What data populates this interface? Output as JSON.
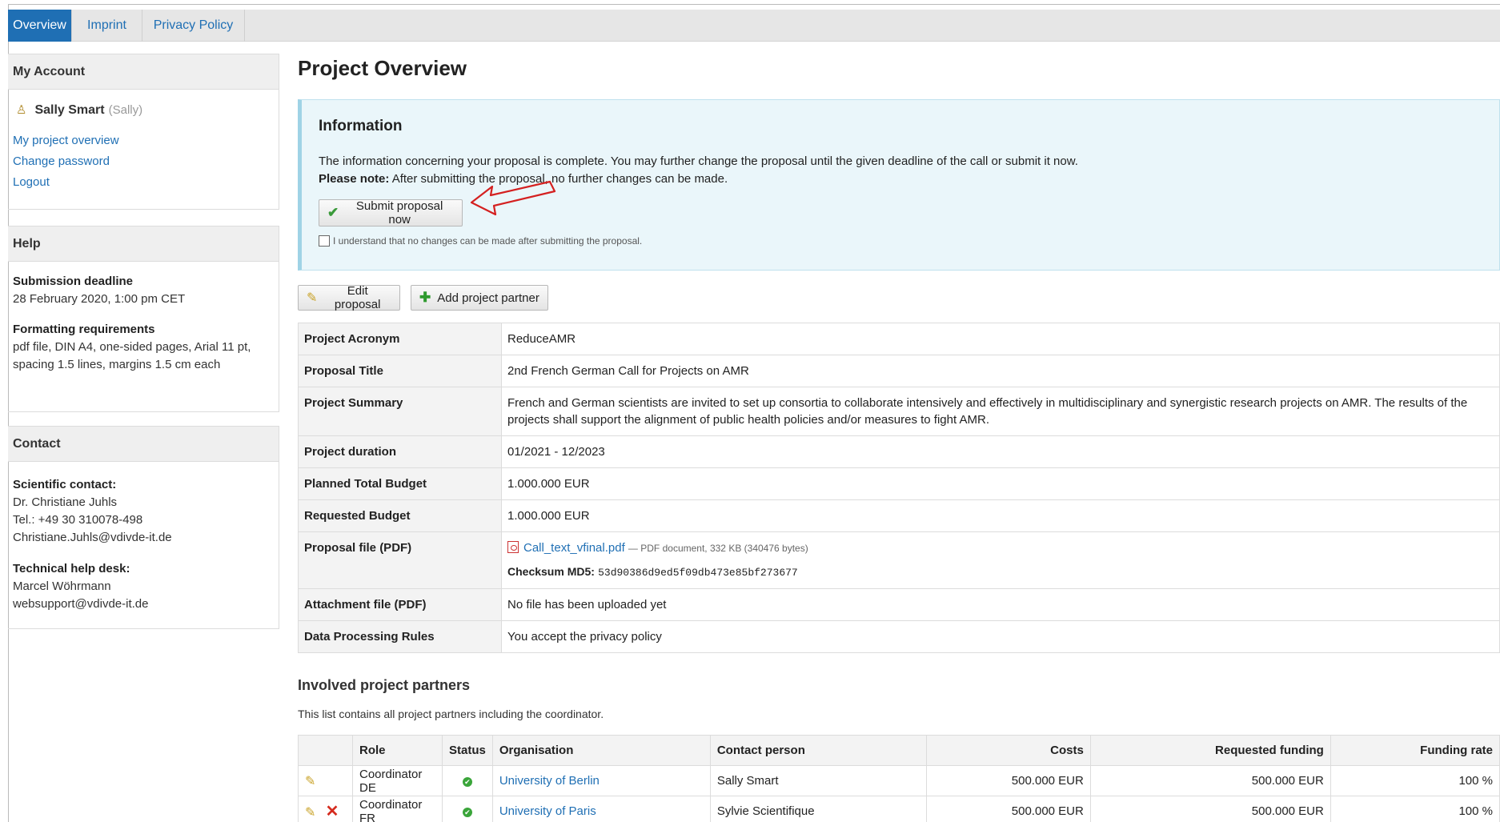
{
  "tabs": [
    {
      "label": "Overview"
    },
    {
      "label": "Imprint"
    },
    {
      "label": "Privacy Policy"
    }
  ],
  "account": {
    "heading": "My Account",
    "name": "Sally Smart",
    "username": "(Sally)",
    "links": [
      "My project overview",
      "Change password",
      "Logout"
    ]
  },
  "help": {
    "heading": "Help",
    "deadline_label": "Submission deadline",
    "deadline_value": "28 February 2020, 1:00 pm CET",
    "format_label": "Formatting requirements",
    "format_line1": "pdf file, DIN A4, one-sided pages, Arial 11 pt,",
    "format_line2": "spacing 1.5 lines, margins 1.5 cm each"
  },
  "contact": {
    "heading": "Contact",
    "sci_label": "Scientific contact:",
    "sci_name": "Dr. Christiane Juhls",
    "sci_tel": "Tel.: +49 30 310078-498",
    "sci_email": "Christiane.Juhls@vdivde-it.de",
    "tech_label": "Technical help desk:",
    "tech_name": "Marcel Wöhrmann",
    "tech_email": "websupport@vdivde-it.de"
  },
  "page_title": "Project Overview",
  "info": {
    "heading": "Information",
    "text1": "The information concerning your proposal is complete. You may further change the proposal until the given deadline of the call or submit it now.",
    "note_bold": "Please note:",
    "note_text": " After submitting the proposal, no further changes can be made.",
    "submit_label": "Submit proposal now",
    "ack_label": "I understand that no changes can be made after submitting the proposal."
  },
  "actions": {
    "edit_label": "Edit proposal",
    "add_partner_label": "Add project partner"
  },
  "details": {
    "acronym_label": "Project Acronym",
    "acronym": "ReduceAMR",
    "title_label": "Proposal Title",
    "title": "2nd French German Call for Projects on AMR",
    "summary_label": "Project Summary",
    "summary": "French and German scientists are invited to set up consortia to collaborate intensively and effectively in multidisciplinary and synergistic research projects on AMR. The results of the projects shall support the alignment of public health policies and/or measures to fight AMR.",
    "duration_label": "Project duration",
    "duration": "01/2021 - 12/2023",
    "total_budget_label": "Planned Total Budget",
    "total_budget": "1.000.000 EUR",
    "req_budget_label": "Requested Budget",
    "req_budget": "1.000.000 EUR",
    "proposal_file_label": "Proposal file (PDF)",
    "proposal_file_name": "Call_text_vfinal.pdf",
    "proposal_file_meta": "— PDF document, 332 KB (340476 bytes)",
    "checksum_label": "Checksum MD5:",
    "checksum": "53d90386d9ed5f09db473e85bf273677",
    "attachment_label": "Attachment file (PDF)",
    "attachment": "No file has been uploaded yet",
    "rules_label": "Data Processing Rules",
    "rules": "You accept the privacy policy"
  },
  "partners": {
    "heading": "Involved project partners",
    "description": "This list contains all project partners including the coordinator.",
    "columns": [
      "Role",
      "Status",
      "Organisation",
      "Contact person",
      "Costs",
      "Requested funding",
      "Funding rate"
    ],
    "rows": [
      {
        "role": "Coordinator DE",
        "org": "University of Berlin",
        "contact": "Sally Smart",
        "costs": "500.000 EUR",
        "funding": "500.000 EUR",
        "rate": "100 %"
      },
      {
        "role": "Coordinator FR",
        "org": "University of Paris",
        "contact": "Sylvie Scientifique",
        "costs": "500.000 EUR",
        "funding": "500.000 EUR",
        "rate": "100 %"
      }
    ]
  },
  "colors": {
    "accent": "#1f6fb4",
    "info_bg": "#eaf6fa",
    "status_ok": "#3aa53a",
    "delete": "#d52b1e"
  }
}
